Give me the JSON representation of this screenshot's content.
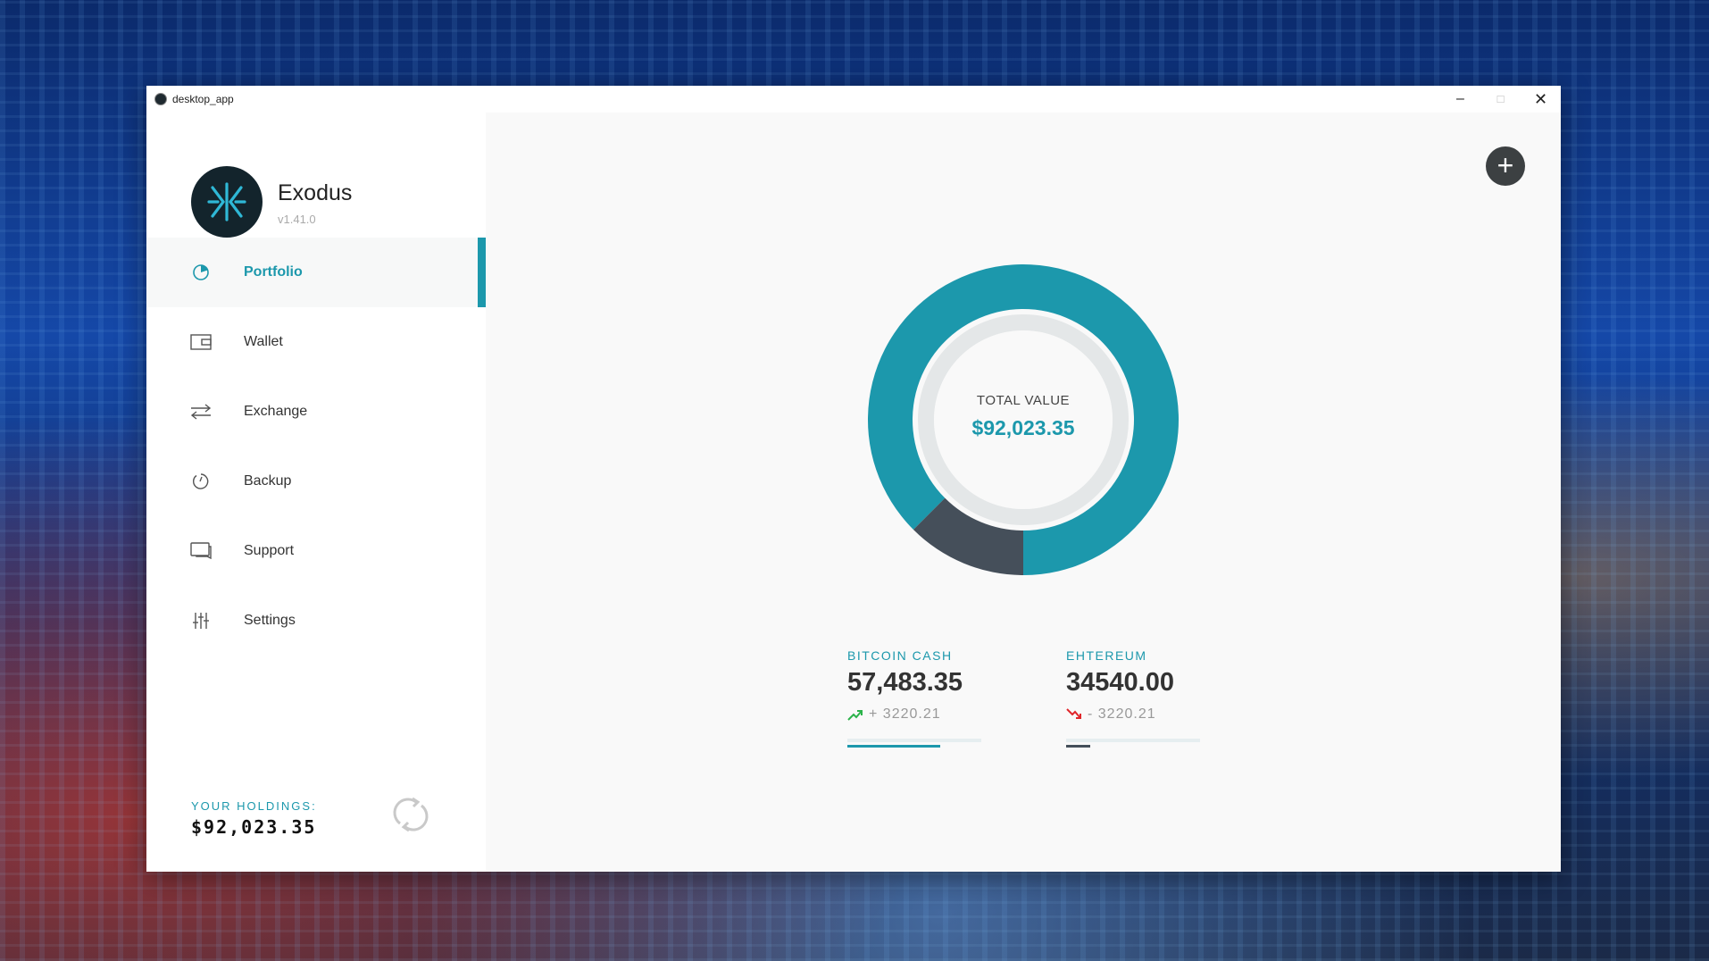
{
  "window": {
    "title": "desktop_app"
  },
  "brand": {
    "name": "Exodus",
    "version": "v1.41.0"
  },
  "nav": [
    {
      "label": "Portfolio",
      "icon": "pie-chart-icon",
      "active": true
    },
    {
      "label": "Wallet",
      "icon": "wallet-icon",
      "active": false
    },
    {
      "label": "Exchange",
      "icon": "exchange-arrows-icon",
      "active": false
    },
    {
      "label": "Backup",
      "icon": "backup-icon",
      "active": false
    },
    {
      "label": "Support",
      "icon": "chat-icon",
      "active": false
    },
    {
      "label": "Settings",
      "icon": "sliders-icon",
      "active": false
    }
  ],
  "holdings": {
    "label": "YOUR HOLDINGS:",
    "value": "$92,023.35"
  },
  "portfolio": {
    "total_label": "TOTAL VALUE",
    "total_value": "$92,023.35",
    "assets": [
      {
        "name": "BITCOIN CASH",
        "amount": "57,483.35",
        "change": "+ 3220.21",
        "trend": "up",
        "bar_fraction": 0.69,
        "color": "#1c98ac"
      },
      {
        "name": "EHTEREUM",
        "amount": "34540.00",
        "change": "- 3220.21",
        "trend": "down",
        "bar_fraction": 0.18,
        "color": "#454f5a"
      }
    ]
  },
  "chart_data": {
    "type": "pie",
    "categories": [
      "BITCOIN CASH",
      "EHTEREUM"
    ],
    "values": [
      0.875,
      0.125
    ],
    "colors": [
      "#1c98ac",
      "#454f5a"
    ]
  },
  "colors": {
    "accent": "#1c98ac",
    "dark": "#454f5a",
    "up": "#2bb34a",
    "down": "#e0262b"
  }
}
